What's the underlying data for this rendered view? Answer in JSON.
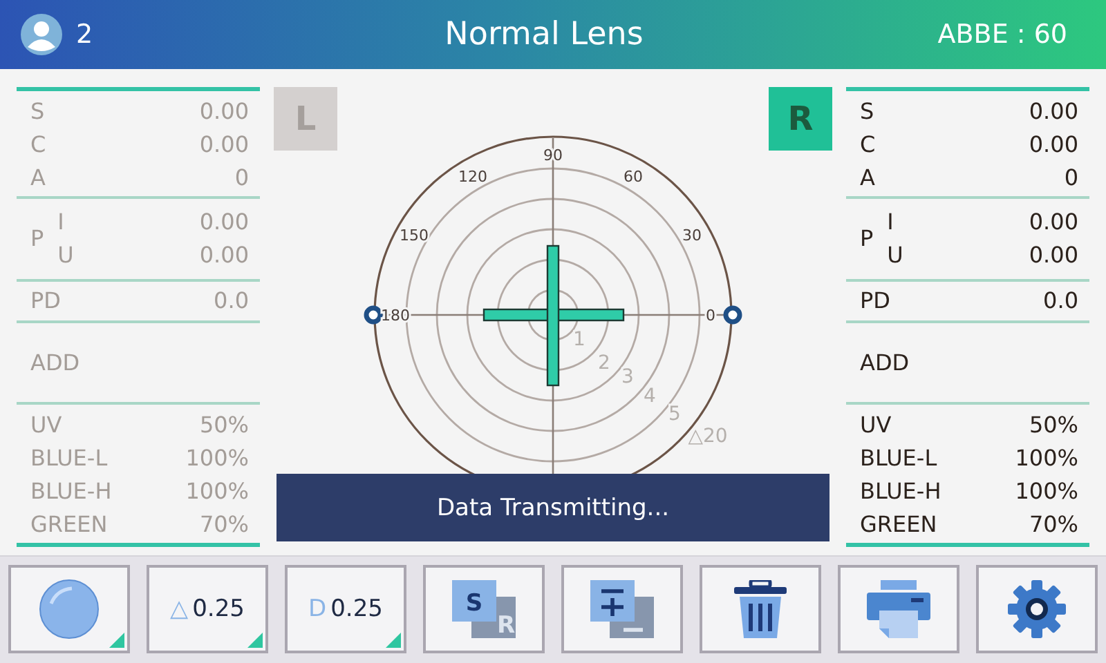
{
  "header": {
    "user_count": "2",
    "title": "Normal Lens",
    "abbe": "ABBE : 60"
  },
  "panels": [
    {
      "selected": false,
      "sections": [
        {
          "kind": "rows",
          "rows": [
            {
              "label": "S",
              "value": "0.00"
            },
            {
              "label": "C",
              "value": "0.00"
            },
            {
              "label": "A",
              "value": "0"
            }
          ]
        },
        {
          "kind": "prism",
          "label": "P",
          "rows": [
            {
              "label": "I",
              "value": "0.00"
            },
            {
              "label": "U",
              "value": "0.00"
            }
          ]
        },
        {
          "kind": "rows",
          "rows": [
            {
              "label": "PD",
              "value": "0.0"
            }
          ]
        },
        {
          "kind": "add",
          "rows": [
            {
              "label": "ADD"
            }
          ]
        },
        {
          "kind": "rows",
          "rows": [
            {
              "label": "UV",
              "value": "50%"
            },
            {
              "label": "BLUE-L",
              "value": "100%"
            },
            {
              "label": "BLUE-H",
              "value": "100%"
            },
            {
              "label": "GREEN",
              "value": "70%"
            }
          ]
        }
      ]
    },
    {
      "selected": true,
      "sections": [
        {
          "kind": "rows",
          "rows": [
            {
              "label": "S",
              "value": "0.00"
            },
            {
              "label": "C",
              "value": "0.00"
            },
            {
              "label": "A",
              "value": "0"
            }
          ]
        },
        {
          "kind": "prism",
          "label": "P",
          "rows": [
            {
              "label": "I",
              "value": "0.00"
            },
            {
              "label": "U",
              "value": "0.00"
            }
          ]
        },
        {
          "kind": "rows",
          "rows": [
            {
              "label": "PD",
              "value": "0.0"
            }
          ]
        },
        {
          "kind": "add",
          "rows": [
            {
              "label": "ADD"
            }
          ]
        },
        {
          "kind": "rows",
          "rows": [
            {
              "label": "UV",
              "value": "50%"
            },
            {
              "label": "BLUE-L",
              "value": "100%"
            },
            {
              "label": "BLUE-H",
              "value": "100%"
            },
            {
              "label": "GREEN",
              "value": "70%"
            }
          ]
        }
      ]
    }
  ],
  "sides": [
    {
      "label": "L",
      "selected": false
    },
    {
      "label": "R",
      "selected": true
    }
  ],
  "target": {
    "angle_labels": [
      "0",
      "30",
      "60",
      "90",
      "120",
      "150",
      "180"
    ],
    "ring_labels": [
      "1",
      "2",
      "3",
      "4",
      "5",
      "△20"
    ]
  },
  "banner": "Data Transmitting...",
  "toolbar": [
    {
      "kind": "lens"
    },
    {
      "kind": "value",
      "prefix": "△",
      "value": "0.25"
    },
    {
      "kind": "value",
      "prefix": "D",
      "value": "0.25"
    },
    {
      "kind": "sr",
      "letters": [
        "S",
        "R"
      ]
    },
    {
      "kind": "plusminus"
    },
    {
      "kind": "trash"
    },
    {
      "kind": "printer"
    },
    {
      "kind": "gear"
    }
  ]
}
